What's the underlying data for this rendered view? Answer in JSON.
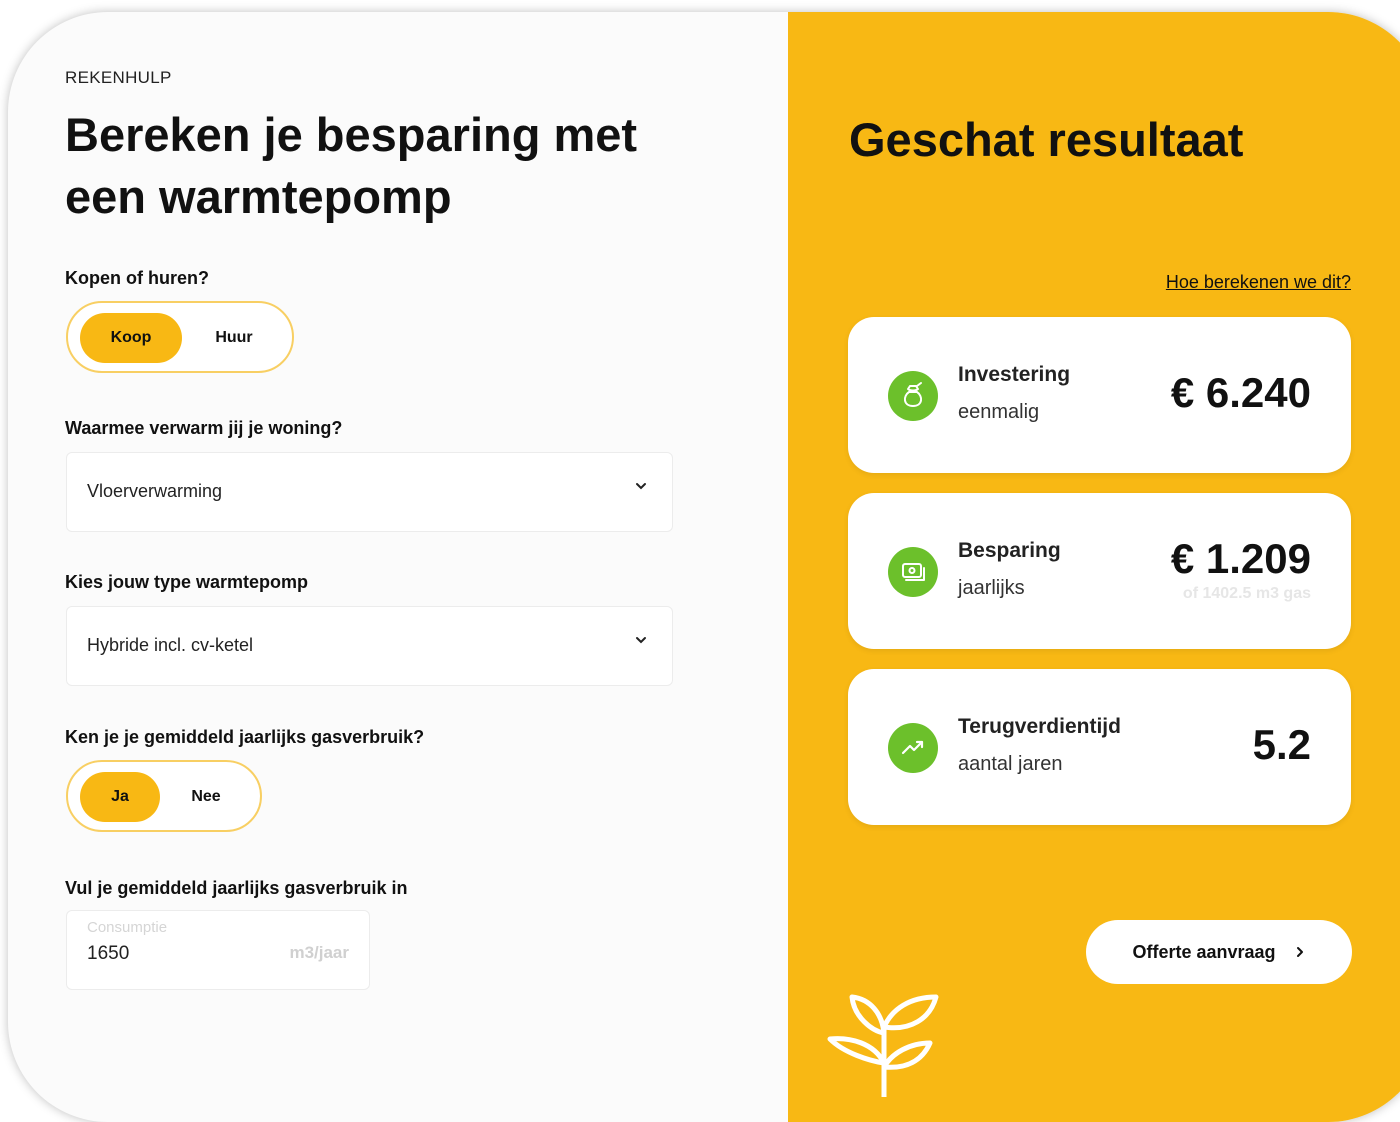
{
  "left": {
    "eyebrow": "REKENHULP",
    "title": "Bereken je besparing met een warmtepomp",
    "q_buy_rent": {
      "label": "Kopen of huren?",
      "options": [
        "Koop",
        "Huur"
      ],
      "selected": "Koop"
    },
    "q_heating": {
      "label": "Waarmee verwarm jij je woning?",
      "value": "Vloerverwarming"
    },
    "q_pump_type": {
      "label": "Kies jouw type warmtepomp",
      "value": "Hybride incl. cv-ketel"
    },
    "q_know_usage": {
      "label": "Ken je je gemiddeld jaarlijks gasverbruik?",
      "options": [
        "Ja",
        "Nee"
      ],
      "selected": "Ja"
    },
    "q_usage_input": {
      "label": "Vul je gemiddeld jaarlijks gasverbruik in",
      "field_label": "Consumptie",
      "value": "1650",
      "unit": "m3/jaar"
    }
  },
  "right": {
    "title": "Geschat resultaat",
    "link": "Hoe berekenen we dit?",
    "results": [
      {
        "name": "Investering",
        "sub": "eenmalig",
        "value": "€ 6.240",
        "note": "",
        "icon": "money-bag-icon"
      },
      {
        "name": "Besparing",
        "sub": "jaarlijks",
        "value": "€ 1.209",
        "note": "of 1402.5 m3 gas",
        "icon": "cash-icon"
      },
      {
        "name": "Terugverdientijd",
        "sub": "aantal jaren",
        "value": "5.2",
        "note": "",
        "icon": "trend-up-icon"
      }
    ],
    "cta": "Offerte aanvraag"
  },
  "colors": {
    "accent": "#f8b814",
    "accent_border": "#f8cf63",
    "icon_green": "#6cc02b",
    "background_left": "#fbfbfb"
  }
}
